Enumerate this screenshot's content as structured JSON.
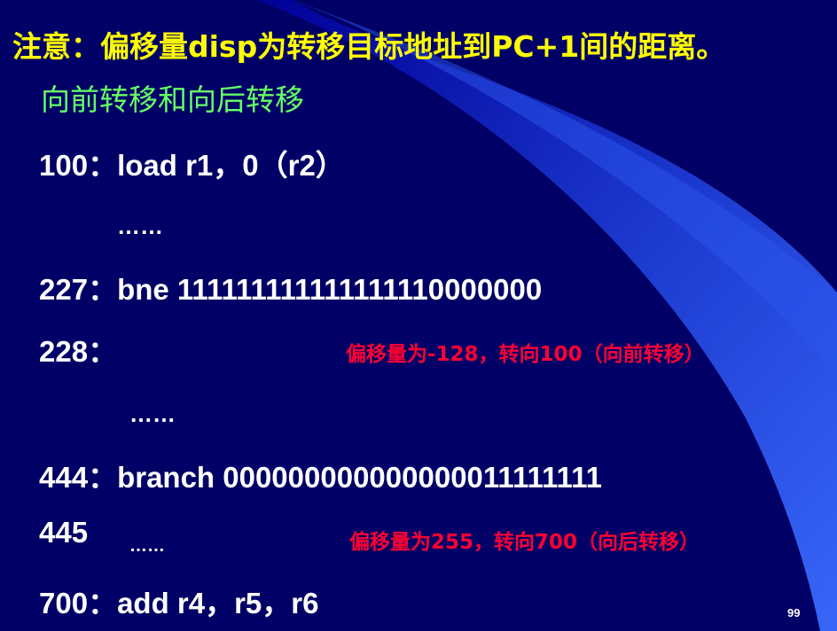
{
  "slide": {
    "title": "注意：偏移量disp为转移目标地址到PC+1间的距离。",
    "subtitle": "向前转移和向后转移",
    "lines": {
      "l100": {
        "addr": "100",
        "sep": "：",
        "instr": "load r1，0（r2）"
      },
      "dots1": "……",
      "l227": {
        "addr": "227",
        "sep": "：",
        "instr": "bne  111111111111111110000000"
      },
      "l228": {
        "addr": "228",
        "sep": "："
      },
      "note1": "偏移量为-128，转向100（向前转移）",
      "dots2": "……",
      "l444": {
        "addr": "444",
        "sep": "：",
        "instr": "branch 000000000000000011111111"
      },
      "l445": {
        "addr": "445"
      },
      "dots3": "……",
      "note2": "偏移量为255，转向700（向后转移）",
      "l700": {
        "addr": "700",
        "sep": "：",
        "instr": "add r4，r5，r6"
      }
    },
    "page_number": "99"
  }
}
